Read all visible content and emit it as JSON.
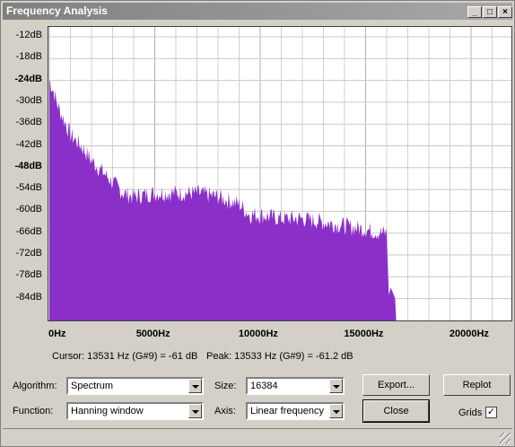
{
  "window": {
    "title": "Frequency Analysis",
    "minimize": "_",
    "maximize": "□",
    "close": "×"
  },
  "chart_data": {
    "type": "area",
    "color": "#8b2fc9",
    "y_ticks": [
      "-12dB",
      "-18dB",
      "-24dB",
      "-30dB",
      "-36dB",
      "-42dB",
      "-48dB",
      "-54dB",
      "-60dB",
      "-66dB",
      "-72dB",
      "-78dB",
      "-84dB"
    ],
    "x_ticks": [
      "0Hz",
      "5000Hz",
      "10000Hz",
      "15000Hz",
      "20000Hz"
    ],
    "xlim": [
      0,
      22050
    ],
    "ylim": [
      -90,
      -9
    ],
    "grid": true,
    "x": [
      0,
      200,
      400,
      700,
      1000,
      1500,
      2000,
      2500,
      3000,
      3500,
      4000,
      5000,
      6000,
      7000,
      8000,
      9000,
      9500,
      10000,
      11000,
      12000,
      13000,
      14000,
      15000,
      15800,
      16000,
      16100,
      16200,
      16400,
      16450
    ],
    "y": [
      -24,
      -27,
      -31,
      -35,
      -39,
      -42,
      -46,
      -49,
      -52,
      -55,
      -56,
      -55,
      -55,
      -55,
      -56,
      -58,
      -61,
      -61,
      -62,
      -62,
      -63,
      -64,
      -65,
      -66,
      -66,
      -83,
      -81,
      -84,
      -90
    ]
  },
  "status": {
    "cursor": "Cursor: 13531 Hz (G#9) = -61 dB",
    "peak": "Peak: 13533 Hz (G#9) = -61.2 dB"
  },
  "controls": {
    "algorithm_label": "Algorithm:",
    "algorithm_value": "Spectrum",
    "function_label": "Function:",
    "function_value": "Hanning window",
    "size_label": "Size:",
    "size_value": "16384",
    "axis_label": "Axis:",
    "axis_value": "Linear frequency",
    "export_label": "Export...",
    "replot_label": "Replot",
    "close_label": "Close",
    "grids_label": "Grids",
    "grids_checked": "✓"
  }
}
